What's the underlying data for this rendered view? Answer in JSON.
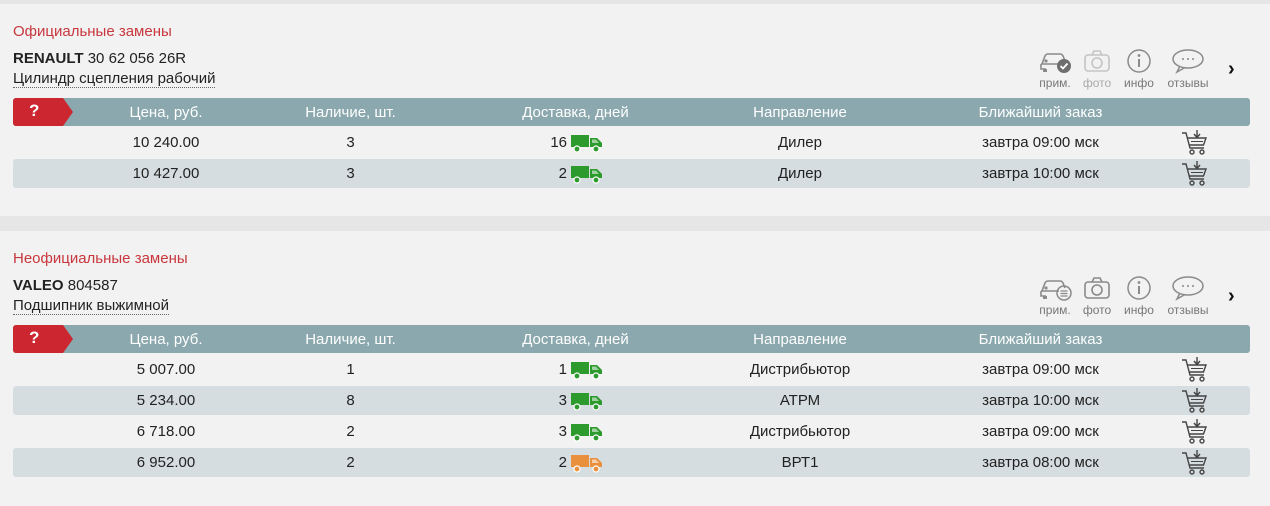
{
  "colors": {
    "section_title": "#c8373d",
    "header_bg": "#8aa8ad",
    "badge_bg": "#cc2630",
    "row_alt_bg": "#d5dde0",
    "truck_green": "#2d9a2d",
    "truck_orange": "#e8903c"
  },
  "columns": {
    "price": "Цена, руб.",
    "availability": "Наличие, шт.",
    "delivery": "Доставка, дней",
    "direction": "Направление",
    "nearest_order": "Ближайший заказ"
  },
  "badge": "?",
  "tools": {
    "apply": "прим.",
    "photo": "фото",
    "info": "инфо",
    "reviews": "отзывы"
  },
  "chevron": "›",
  "sections": [
    {
      "title": "Официальные замены",
      "brand": "RENAULT",
      "article": "30 62 056 26R",
      "description": "Цилиндр сцепления рабочий",
      "apply_icon": "car-check-icon",
      "photo_available": false,
      "rows": [
        {
          "price": "10 240.00",
          "availability": "3",
          "delivery": "16",
          "truck": "green",
          "direction": "Дилер",
          "nearest": "завтра 09:00 мск"
        },
        {
          "price": "10 427.00",
          "availability": "3",
          "delivery": "2",
          "truck": "green",
          "direction": "Дилер",
          "nearest": "завтра 10:00 мск"
        }
      ]
    },
    {
      "title": "Неофициальные замены",
      "brand": "VALEO",
      "article": "804587",
      "description": "Подшипник выжимной",
      "apply_icon": "car-list-icon",
      "photo_available": true,
      "rows": [
        {
          "price": "5 007.00",
          "availability": "1",
          "delivery": "1",
          "truck": "green",
          "direction": "Дистрибьютор",
          "nearest": "завтра 09:00 мск"
        },
        {
          "price": "5 234.00",
          "availability": "8",
          "delivery": "3",
          "truck": "green",
          "direction": "АТРМ",
          "nearest": "завтра 10:00 мск"
        },
        {
          "price": "6 718.00",
          "availability": "2",
          "delivery": "3",
          "truck": "green",
          "direction": "Дистрибьютор",
          "nearest": "завтра 09:00 мск"
        },
        {
          "price": "6 952.00",
          "availability": "2",
          "delivery": "2",
          "truck": "orange",
          "direction": "ВРТ1",
          "nearest": "завтра 08:00 мск"
        }
      ]
    }
  ]
}
